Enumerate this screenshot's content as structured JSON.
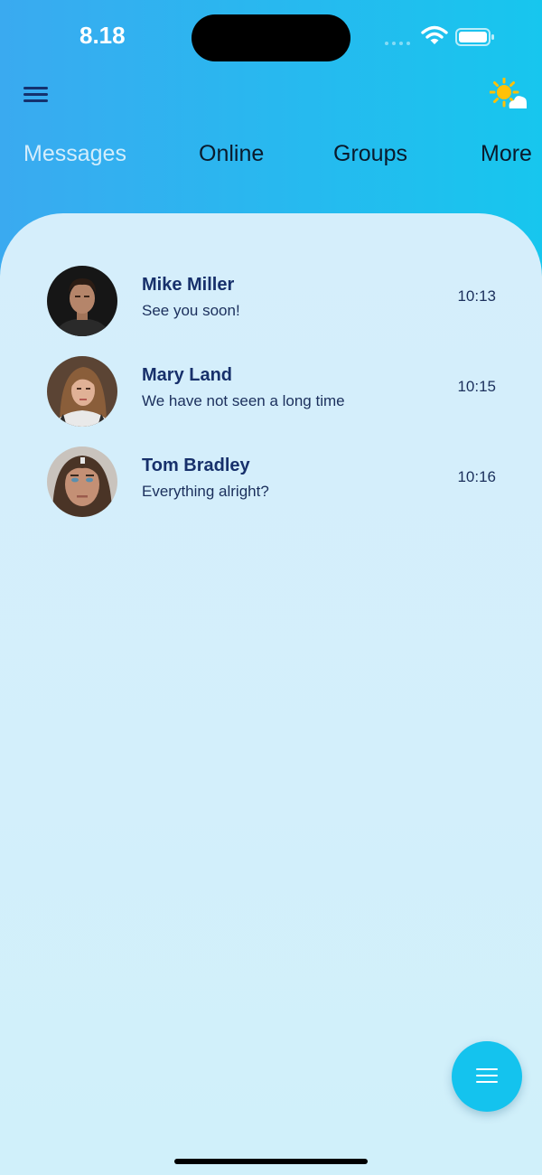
{
  "status_bar": {
    "time": "8.18",
    "icons": [
      "signal-icon",
      "wifi-icon",
      "battery-icon"
    ]
  },
  "header": {
    "menu_icon": "hamburger-menu-icon",
    "weather_icon": "sun-cloud-icon"
  },
  "tabs": [
    {
      "label": "Messages",
      "active": true
    },
    {
      "label": "Online",
      "active": false
    },
    {
      "label": "Groups",
      "active": false
    },
    {
      "label": "More",
      "active": false
    }
  ],
  "chats": [
    {
      "name": "Mike Miller",
      "message": "See you soon!",
      "time": "10:13"
    },
    {
      "name": "Mary Land",
      "message": "We have not seen a long time",
      "time": "10:15"
    },
    {
      "name": "Tom Bradley",
      "message": "Everything alright?",
      "time": "10:16"
    }
  ],
  "fab": {
    "icon": "menu-lines-icon"
  },
  "colors": {
    "header_gradient_start": "#3aaaf0",
    "header_gradient_end": "#17c6ee",
    "panel_background": "#d5eefb",
    "name_text": "#17306b",
    "fab_background": "#14c3ee"
  }
}
